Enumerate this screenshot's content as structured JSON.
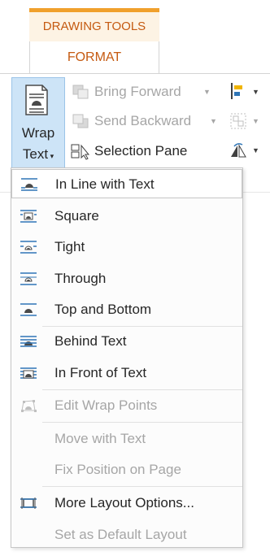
{
  "ribbon": {
    "contextual_group": "DRAWING TOOLS",
    "active_tab": "FORMAT",
    "wrap_text": {
      "line1": "Wrap",
      "line2": "Text"
    },
    "bring_forward": "Bring Forward",
    "send_backward": "Send Backward",
    "selection_pane": "Selection Pane",
    "accent_color": "#c55a11"
  },
  "menu": {
    "items": [
      {
        "label": "In Line with Text",
        "icon": "inline-icon",
        "enabled": true,
        "highlighted": true
      },
      {
        "label": "Square",
        "icon": "square-wrap-icon",
        "enabled": true
      },
      {
        "label": "Tight",
        "icon": "tight-wrap-icon",
        "enabled": true
      },
      {
        "label": "Through",
        "icon": "through-wrap-icon",
        "enabled": true
      },
      {
        "label": "Top and Bottom",
        "icon": "top-bottom-wrap-icon",
        "enabled": true
      },
      {
        "label": "Behind Text",
        "icon": "behind-text-icon",
        "enabled": true
      },
      {
        "label": "In Front of Text",
        "icon": "in-front-text-icon",
        "enabled": true
      },
      {
        "label": "Edit Wrap Points",
        "icon": "edit-wrap-points-icon",
        "enabled": false
      },
      {
        "label": "Move with Text",
        "enabled": false
      },
      {
        "label": "Fix Position on Page",
        "enabled": false
      },
      {
        "label": "More Layout Options...",
        "icon": "layout-options-icon",
        "enabled": true
      },
      {
        "label": "Set as Default Layout",
        "enabled": false
      }
    ]
  }
}
